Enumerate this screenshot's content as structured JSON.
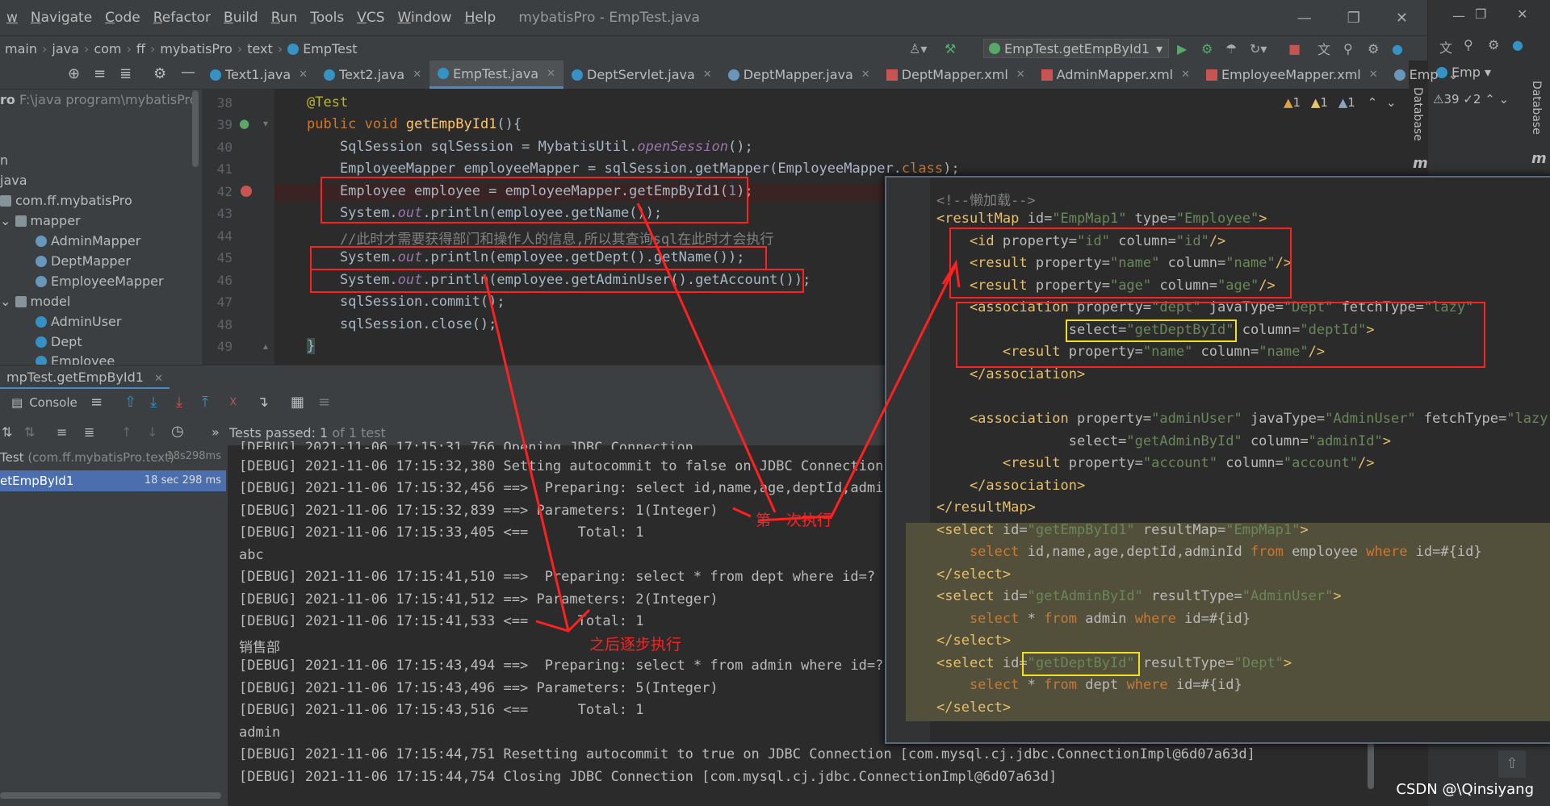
{
  "menubar": {
    "items": [
      "w",
      "Navigate",
      "Code",
      "Refactor",
      "Build",
      "Run",
      "Tools",
      "VCS",
      "Window",
      "Help"
    ],
    "window_title": "mybatisPro - EmpTest.java"
  },
  "navbar": {
    "breadcrumbs": [
      "main",
      "java",
      "com",
      "ff",
      "mybatisPro",
      "text",
      "EmpTest"
    ],
    "run_config": "EmpTest.getEmpById1"
  },
  "project": {
    "root": "ro",
    "root_path": "F:\\java program\\mybatisPro",
    "items": [
      "n",
      "java",
      "com.ff.mybatisPro",
      "mapper",
      "AdminMapper",
      "DeptMapper",
      "EmployeeMapper",
      "model",
      "AdminUser",
      "Dept",
      "Employee"
    ]
  },
  "tabs": [
    "Text1.java",
    "Text2.java",
    "EmpTest.java",
    "DeptServlet.java",
    "DeptMapper.java",
    "DeptMapper.xml",
    "AdminMapper.xml",
    "EmployeeMapper.xml",
    "Emp"
  ],
  "right_tabs": [
    "Emp"
  ],
  "inspections": {
    "w1": "1",
    "w2": "1",
    "w3": "1",
    "right_count": "39",
    "right_count2": "2"
  },
  "side_labels": {
    "database": "Database",
    "m": "m"
  },
  "editor": {
    "line_numbers": [
      "38",
      "39",
      "40",
      "41",
      "42",
      "43",
      "44",
      "45",
      "46",
      "47",
      "48",
      "49"
    ],
    "lines": [
      {
        "annotation": "@Test"
      },
      {
        "kw": "public void ",
        "fn": "getEmpById1",
        "rest": "(){"
      },
      {
        "a": "    SqlSession sqlSession = MybatisUtil.",
        "it": "openSession",
        "b": "();"
      },
      {
        "a": "    EmployeeMapper employeeMapper = sqlSession.getMapper(EmployeeMapper.",
        "kw": "class",
        "b": ");"
      },
      {
        "a": "    Employee employee = employeeMapper.getEmpById1(",
        "num": "1",
        "b": ");"
      },
      {
        "a": "    System.",
        "it": "out",
        "b": ".println(employee.getName());"
      },
      {
        "comment": "    //此时才需要获得部门和操作人的信息,所以其查询sql在此时才会执行"
      },
      {
        "a": "    System.",
        "it": "out",
        "b": ".println(employee.getDept().getName());"
      },
      {
        "a": "    System.",
        "it": "out",
        "b": ".println(employee.getAdminUser().getAccount());"
      },
      {
        "a": "    sqlSession.commit();"
      },
      {
        "a": "    sqlSession.close();"
      },
      {
        "a": "}"
      }
    ]
  },
  "run": {
    "tab": "mpTest.getEmpById1",
    "console_label": "Console",
    "tests_passed": "Tests passed: ",
    "tests_count": "1",
    "tests_of": " of 1 test",
    "tree": [
      {
        "name": "Test",
        "pkg": " (com.ff.mybatisPro.text)",
        "time": "18s298ms"
      },
      {
        "name": "etEmpById1",
        "time": "18 sec 298 ms"
      }
    ]
  },
  "console": [
    "[DEBUG] 2021-11-06 17:15:31,766 Opening JDBC Connection",
    "[DEBUG] 2021-11-06 17:15:32,380 Setting autocommit to false on JDBC Connection [",
    "[DEBUG] 2021-11-06 17:15:32,456 ==>  Preparing: select id,name,age,deptId,adminI",
    "[DEBUG] 2021-11-06 17:15:32,839 ==> Parameters: 1(Integer)",
    "[DEBUG] 2021-11-06 17:15:33,405 <==      Total: 1",
    "abc",
    "[DEBUG] 2021-11-06 17:15:41,510 ==>  Preparing: select * from dept where id=?",
    "[DEBUG] 2021-11-06 17:15:41,512 ==> Parameters: 2(Integer)",
    "[DEBUG] 2021-11-06 17:15:41,533 <==      Total: 1",
    "销售部",
    "[DEBUG] 2021-11-06 17:15:43,494 ==>  Preparing: select * from admin where id=?",
    "[DEBUG] 2021-11-06 17:15:43,496 ==> Parameters: 5(Integer)",
    "[DEBUG] 2021-11-06 17:15:43,516 <==      Total: 1",
    "admin",
    "[DEBUG] 2021-11-06 17:15:44,751 Resetting autocommit to true on JDBC Connection [com.mysql.cj.jdbc.ConnectionImpl@6d07a63d]",
    "[DEBUG] 2021-11-06 17:15:44,754 Closing JDBC Connection [com.mysql.cj.jdbc.ConnectionImpl@6d07a63d]"
  ],
  "xml": [
    {
      "c": "<!--懒加载-->"
    },
    {
      "t": "<resultMap ",
      "a": "id=",
      "v": "\"EmpMap1\"",
      "a2": " type=",
      "v2": "\"Employee\"",
      "e": ">"
    },
    {
      "t": "    <id ",
      "a": "property=",
      "v": "\"id\"",
      "a2": " column=",
      "v2": "\"id\"",
      "e": "/>"
    },
    {
      "t": "    <result ",
      "a": "property=",
      "v": "\"name\"",
      "a2": " column=",
      "v2": "\"name\"",
      "e": "/>"
    },
    {
      "t": "    <result ",
      "a": "property=",
      "v": "\"age\"",
      "a2": " column=",
      "v2": "\"age\"",
      "e": "/>"
    },
    {
      "t": "    <association ",
      "a": "property=",
      "v": "\"dept\"",
      "a2": " javaType=",
      "v2": "\"Dept\"",
      "a3": " fetchType=",
      "v3": "\"lazy\""
    },
    {
      "t": "",
      "a": "                select=",
      "v": "\"getDeptById\"",
      "a2": " column=",
      "v2": "\"deptId\"",
      "e": ">"
    },
    {
      "t": "        <result ",
      "a": "property=",
      "v": "\"name\"",
      "a2": " column=",
      "v2": "\"name\"",
      "e": "/>"
    },
    {
      "t": "    </association>"
    },
    {
      "t": ""
    },
    {
      "t": "    <association ",
      "a": "property=",
      "v": "\"adminUser\"",
      "a2": " javaType=",
      "v2": "\"AdminUser\"",
      "a3": " fetchType=",
      "v3": "\"lazy\""
    },
    {
      "t": "",
      "a": "                select=",
      "v": "\"getAdminById\"",
      "a2": " column=",
      "v2": "\"adminId\"",
      "e": ">"
    },
    {
      "t": "        <result ",
      "a": "property=",
      "v": "\"account\"",
      "a2": " column=",
      "v2": "\"account\"",
      "e": "/>"
    },
    {
      "t": "    </association>"
    },
    {
      "t": "</resultMap>"
    },
    {
      "t": "<select ",
      "a": "id=",
      "v": "\"getEmpById1\"",
      "a2": " resultMap=",
      "v2": "\"EmpMap1\"",
      "e": ">"
    },
    {
      "s": "    select ",
      "x": "id,name,age,deptId,adminId ",
      "s2": "from ",
      "x2": "employee ",
      "s3": "where ",
      "x3": "id=#{id}"
    },
    {
      "t": "</select>"
    },
    {
      "t": "<select ",
      "a": "id=",
      "v": "\"getAdminById\"",
      "a2": " resultType=",
      "v2": "\"AdminUser\"",
      "e": ">"
    },
    {
      "s": "    select ",
      "x": "* ",
      "s2": "from ",
      "x2": "admin ",
      "s3": "where ",
      "x3": "id=#{id}"
    },
    {
      "t": "</select>"
    },
    {
      "t": "<select ",
      "a": "id=",
      "v": "\"getDeptById\"",
      "a2": " resultType=",
      "v2": "\"Dept\"",
      "e": ">"
    },
    {
      "s": "    select ",
      "x": "* ",
      "s2": "from ",
      "x2": "dept ",
      "s3": "where ",
      "x3": "id=#{id}"
    },
    {
      "t": "</select>"
    }
  ],
  "annotations": {
    "first": "第一次执行",
    "later": "之后逐步执行"
  },
  "watermark": "CSDN @\\Qinsiyang",
  "colors": {
    "annotation_red": "#ff2020",
    "highlight_yellow": "#f0e020",
    "accent_blue": "#4a88c7"
  }
}
